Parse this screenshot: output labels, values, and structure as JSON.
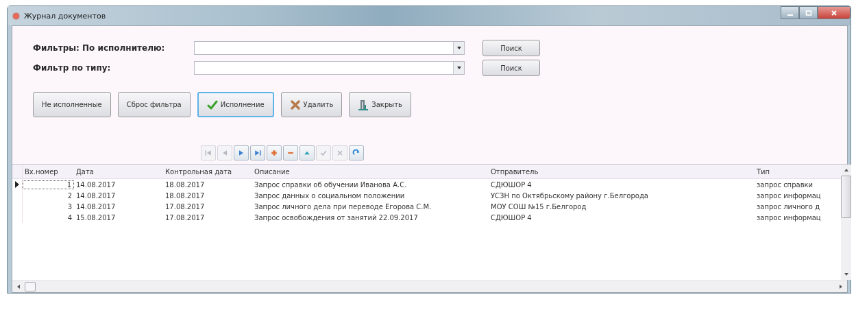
{
  "window": {
    "title": "Журнал документов"
  },
  "filters": [
    {
      "label": "Фильтры: По исполнителю:",
      "button": "Поиск"
    },
    {
      "label": "Фильтр по типу:",
      "button": "Поиск"
    }
  ],
  "actions": [
    {
      "label": "Не исполненные",
      "focused": false
    },
    {
      "label": "Сброс фильтра",
      "focused": false
    },
    {
      "label": "Исполнение",
      "focused": true
    },
    {
      "label": "Удалить",
      "focused": false
    },
    {
      "label": "Закрыть",
      "focused": false
    }
  ],
  "navigator": [
    {
      "kind": "first",
      "disabled": true
    },
    {
      "kind": "prior",
      "disabled": true
    },
    {
      "kind": "next",
      "disabled": false
    },
    {
      "kind": "last",
      "disabled": false
    },
    {
      "kind": "insert",
      "disabled": false
    },
    {
      "kind": "delete",
      "disabled": false
    },
    {
      "kind": "edit",
      "disabled": false
    },
    {
      "kind": "post",
      "disabled": true
    },
    {
      "kind": "cancel",
      "disabled": true
    },
    {
      "kind": "refresh",
      "disabled": false
    }
  ],
  "table": {
    "columns": [
      "Вх.номер",
      "Дата",
      "Контрольная дата",
      "Описание",
      "Отправитель",
      "Тип"
    ],
    "rows": [
      {
        "selected": true,
        "cells": [
          "1",
          "14.08.2017",
          "18.08.2017",
          "Запрос справки об обучении Иванова А.С.",
          "СДЮШОР 4",
          "запрос справки"
        ]
      },
      {
        "selected": false,
        "cells": [
          "2",
          "14.08.2017",
          "18.08.2017",
          "Запрос данных о социальном положении",
          "УСЗН по Октябрьскому району г.Белгорода",
          "запрос информац"
        ]
      },
      {
        "selected": false,
        "cells": [
          "3",
          "14.08.2017",
          "17.08.2017",
          "Запрос личного дела при переводе Егорова С.М.",
          "МОУ СОШ №15 г.Белгород",
          "запрос личного д"
        ]
      },
      {
        "selected": false,
        "cells": [
          "4",
          "15.08.2017",
          "17.08.2017",
          "Запрос освобождения от занятий 22.09.2017",
          "СДЮШОР 4",
          "запрос информац"
        ]
      }
    ]
  }
}
